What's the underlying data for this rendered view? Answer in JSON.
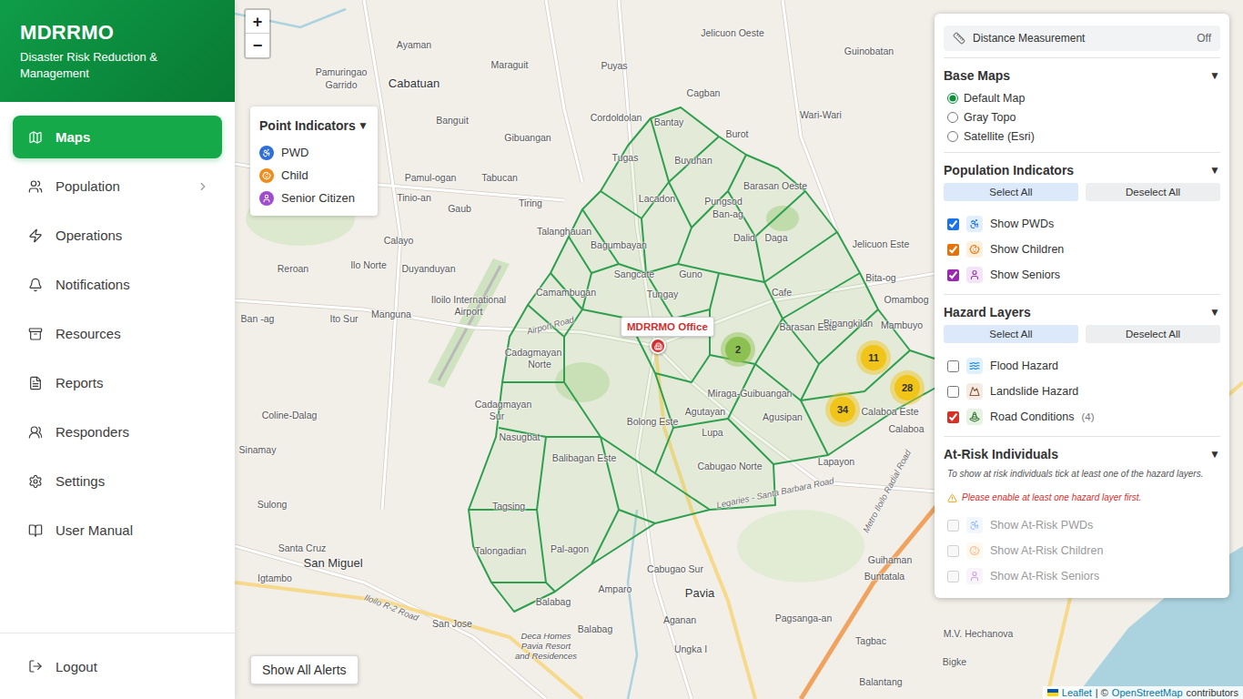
{
  "sidebar": {
    "title": "MDRRMO",
    "subtitle": "Disaster Risk Reduction & Management",
    "items": [
      {
        "label": "Maps",
        "selected": true,
        "has_submenu": false
      },
      {
        "label": "Population",
        "selected": false,
        "has_submenu": true
      },
      {
        "label": "Operations",
        "selected": false,
        "has_submenu": false
      },
      {
        "label": "Notifications",
        "selected": false,
        "has_submenu": false
      },
      {
        "label": "Resources",
        "selected": false,
        "has_submenu": false
      },
      {
        "label": "Reports",
        "selected": false,
        "has_submenu": false
      },
      {
        "label": "Responders",
        "selected": false,
        "has_submenu": false
      },
      {
        "label": "Settings",
        "selected": false,
        "has_submenu": false
      },
      {
        "label": "User Manual",
        "selected": false,
        "has_submenu": false
      }
    ],
    "logout": "Logout"
  },
  "map": {
    "zoom_in": "+",
    "zoom_out": "−",
    "office_label": "MDRRMO Office",
    "clusters": [
      {
        "count": "2",
        "color": "#8cc152"
      },
      {
        "count": "11",
        "color": "#f0c419"
      },
      {
        "count": "28",
        "color": "#f0c419"
      },
      {
        "count": "34",
        "color": "#f0c419"
      }
    ],
    "show_alerts": "Show All Alerts",
    "attribution": {
      "leaflet": "Leaflet",
      "separator": "| ©",
      "osm": "OpenStreetMap",
      "suffix": "contributors"
    },
    "labels": [
      {
        "text": "Ayaman",
        "kind": "place"
      },
      {
        "text": "Cabatuan",
        "kind": "town"
      },
      {
        "text": "Maraguit",
        "kind": "place"
      },
      {
        "text": "Puyas",
        "kind": "place"
      },
      {
        "text": "Jelicuon Oeste",
        "kind": "place"
      },
      {
        "text": "Guinobatan",
        "kind": "place"
      },
      {
        "text": "Pamuringao",
        "kind": "place"
      },
      {
        "text": "Garrido",
        "kind": "place"
      },
      {
        "text": "Banguit",
        "kind": "place"
      },
      {
        "text": "Cagban",
        "kind": "place"
      },
      {
        "text": "Wari-Wari",
        "kind": "place"
      },
      {
        "text": "Gibuangan",
        "kind": "place"
      },
      {
        "text": "Cordoldolan",
        "kind": "place"
      },
      {
        "text": "Bantay",
        "kind": "place"
      },
      {
        "text": "Burot",
        "kind": "place"
      },
      {
        "text": "Tugas",
        "kind": "place"
      },
      {
        "text": "Buyuhan",
        "kind": "place"
      },
      {
        "text": "Barasan Oeste",
        "kind": "place"
      },
      {
        "text": "Pamul-ogan",
        "kind": "place"
      },
      {
        "text": "Tabucan",
        "kind": "place"
      },
      {
        "text": "Lacadon",
        "kind": "place"
      },
      {
        "text": "Pungsod",
        "kind": "place"
      },
      {
        "text": "Ban-ag",
        "kind": "place"
      },
      {
        "text": "Dalid",
        "kind": "place"
      },
      {
        "text": "Daga",
        "kind": "place"
      },
      {
        "text": "Tiring",
        "kind": "place"
      },
      {
        "text": "Talanghauan",
        "kind": "place"
      },
      {
        "text": "Jelicuon Este",
        "kind": "place"
      },
      {
        "text": "Tinio-an",
        "kind": "place"
      },
      {
        "text": "Gaub",
        "kind": "place"
      },
      {
        "text": "Bagumbayan",
        "kind": "place"
      },
      {
        "text": "Sangcate",
        "kind": "place"
      },
      {
        "text": "Guno",
        "kind": "place"
      },
      {
        "text": "Cafe",
        "kind": "place"
      },
      {
        "text": "Bita-og",
        "kind": "place"
      },
      {
        "text": "Binangkilan",
        "kind": "place"
      },
      {
        "text": "Omambog",
        "kind": "place"
      },
      {
        "text": "Calayo",
        "kind": "place"
      },
      {
        "text": "Camambugan",
        "kind": "place"
      },
      {
        "text": "Tungay",
        "kind": "place"
      },
      {
        "text": "Reroan",
        "kind": "place"
      },
      {
        "text": "Ilo Norte",
        "kind": "place"
      },
      {
        "text": "Duyanduyan",
        "kind": "place"
      },
      {
        "text": "Iloilo International",
        "kind": "place"
      },
      {
        "text": "Airport",
        "kind": "place"
      },
      {
        "text": "Manguna",
        "kind": "place"
      },
      {
        "text": "Ito Sur",
        "kind": "place"
      },
      {
        "text": "Ban -ag",
        "kind": "place"
      },
      {
        "text": "Barasan Este",
        "kind": "place"
      },
      {
        "text": "Mambuyo",
        "kind": "place"
      },
      {
        "text": "Cadagmayan",
        "kind": "place"
      },
      {
        "text": "Norte",
        "kind": "place"
      },
      {
        "text": "Cadagmayan",
        "kind": "place"
      },
      {
        "text": "Sur",
        "kind": "place"
      },
      {
        "text": "Miraga-Guibuangan",
        "kind": "place"
      },
      {
        "text": "Agusipan",
        "kind": "place"
      },
      {
        "text": "Calaboa Este",
        "kind": "place"
      },
      {
        "text": "Calaboa",
        "kind": "place"
      },
      {
        "text": "Coline-Dalag",
        "kind": "place"
      },
      {
        "text": "Nasugbat",
        "kind": "place"
      },
      {
        "text": "Bolong Este",
        "kind": "place"
      },
      {
        "text": "Agutayan",
        "kind": "place"
      },
      {
        "text": "Lupa",
        "kind": "place"
      },
      {
        "text": "Sinamay",
        "kind": "place"
      },
      {
        "text": "Balibagan Este",
        "kind": "place"
      },
      {
        "text": "Cabugao Norte",
        "kind": "place"
      },
      {
        "text": "Lapayon",
        "kind": "place"
      },
      {
        "text": "Sulong",
        "kind": "place"
      },
      {
        "text": "Tagsing",
        "kind": "place"
      },
      {
        "text": "Santa Cruz",
        "kind": "place"
      },
      {
        "text": "Talongadian",
        "kind": "place"
      },
      {
        "text": "Pal-agon",
        "kind": "place"
      },
      {
        "text": "Guihaman",
        "kind": "place"
      },
      {
        "text": "Buntatala",
        "kind": "place"
      },
      {
        "text": "San Miguel",
        "kind": "town"
      },
      {
        "text": "Igtambo",
        "kind": "place"
      },
      {
        "text": "Cabugao Sur",
        "kind": "place"
      },
      {
        "text": "Balabag",
        "kind": "place"
      },
      {
        "text": "Amparo",
        "kind": "place"
      },
      {
        "text": "Pavia",
        "kind": "town"
      },
      {
        "text": "Pagsanga-an",
        "kind": "place"
      },
      {
        "text": "Tagbac",
        "kind": "place"
      },
      {
        "text": "San Jose",
        "kind": "place"
      },
      {
        "text": "Aganan",
        "kind": "place"
      },
      {
        "text": "Balabag",
        "kind": "place"
      },
      {
        "text": "Ungka I",
        "kind": "place"
      },
      {
        "text": "Bigke",
        "kind": "place"
      },
      {
        "text": "M.V. Hechanova",
        "kind": "place"
      },
      {
        "text": "Balantang",
        "kind": "place"
      },
      {
        "text": "Deca Homes",
        "kind": "estate"
      },
      {
        "text": "Pavia Resort",
        "kind": "estate"
      },
      {
        "text": "and Residences",
        "kind": "estate"
      },
      {
        "text": "Airport Road",
        "kind": "road"
      },
      {
        "text": "Iloilo R-2 Road",
        "kind": "road"
      },
      {
        "text": "Legaries - Santa Barbara Road",
        "kind": "road"
      },
      {
        "text": "Metro Iloilo Radial Road",
        "kind": "road"
      }
    ]
  },
  "legend": {
    "title": "Point Indicators",
    "toggle": "▼",
    "items": [
      {
        "label": "PWD",
        "color": "#2f6fd6"
      },
      {
        "label": "Child",
        "color": "#f08c1a"
      },
      {
        "label": "Senior Citizen",
        "color": "#a04ccf"
      }
    ]
  },
  "panel": {
    "distance": {
      "label": "Distance Measurement",
      "state": "Off"
    },
    "base_maps": {
      "title": "Base Maps",
      "toggle": "▼",
      "options": [
        {
          "label": "Default Map",
          "selected": true
        },
        {
          "label": "Gray Topo",
          "selected": false
        },
        {
          "label": "Satellite (Esri)",
          "selected": false
        }
      ]
    },
    "population": {
      "title": "Population Indicators",
      "toggle": "▼",
      "select_all": "Select All",
      "deselect_all": "Deselect All",
      "items": [
        {
          "label": "Show PWDs",
          "checked": true,
          "color": "#1a73e8"
        },
        {
          "label": "Show Children",
          "checked": true,
          "color": "#e8710a"
        },
        {
          "label": "Show Seniors",
          "checked": true,
          "color": "#9c27b0"
        }
      ]
    },
    "hazards": {
      "title": "Hazard Layers",
      "toggle": "▼",
      "select_all": "Select All",
      "deselect_all": "Deselect All",
      "items": [
        {
          "label": "Flood Hazard",
          "checked": false
        },
        {
          "label": "Landslide Hazard",
          "checked": false
        },
        {
          "label": "Road Conditions",
          "checked": true,
          "color": "#d93025",
          "count": "(4)"
        }
      ]
    },
    "at_risk": {
      "title": "At-Risk Individuals",
      "toggle": "▼",
      "note": "To show at risk individuals tick at least one of the hazard layers.",
      "warning": "Please enable at least one hazard layer first.",
      "items": [
        {
          "label": "Show At-Risk PWDs",
          "checked": false,
          "disabled": true
        },
        {
          "label": "Show At-Risk Children",
          "checked": false,
          "disabled": true
        },
        {
          "label": "Show At-Risk Seniors",
          "checked": false,
          "disabled": true
        }
      ]
    }
  }
}
